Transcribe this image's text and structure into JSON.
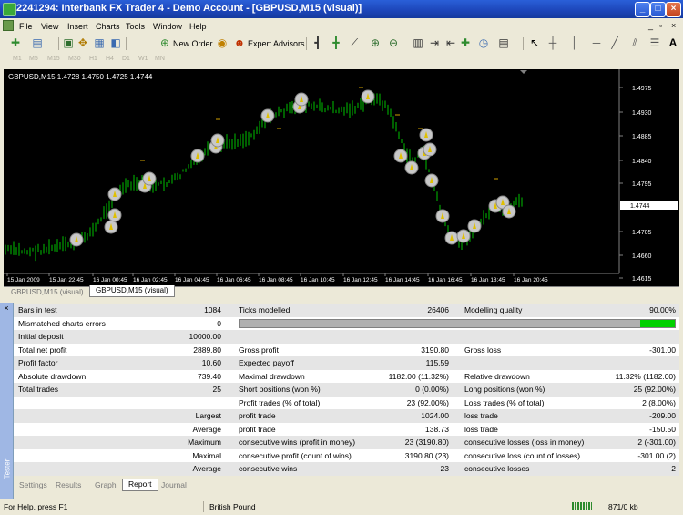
{
  "window": {
    "title": "2241294: Interbank FX Trader 4 - Demo Account - [GBPUSD,M15 (visual)]"
  },
  "menu": [
    "File",
    "View",
    "Insert",
    "Charts",
    "Tools",
    "Window",
    "Help"
  ],
  "toolbar": {
    "new_order_label": "New Order",
    "expert_advisors_label": "Expert Advisors"
  },
  "periods": [
    "M1",
    "M5",
    "M15",
    "M30",
    "H1",
    "H4",
    "D1",
    "W1",
    "MN"
  ],
  "chart": {
    "header": "GBPUSD,M15  1.4728 1.4750 1.4725 1.4744",
    "price_labels": [
      "1.4975",
      "1.4930",
      "1.4885",
      "1.4840",
      "1.4795",
      "1.4705",
      "1.4660",
      "1.4615"
    ],
    "current_price": "1.4744",
    "time_labels": [
      "15 Jan 2009",
      "15 Jan 22:45",
      "16 Jan 00:45",
      "16 Jan 02:45",
      "16 Jan 04:45",
      "16 Jan 06:45",
      "16 Jan 08:45",
      "16 Jan 10:45",
      "16 Jan 12:45",
      "16 Jan 14:45",
      "16 Jan 16:45",
      "16 Jan 18:45",
      "16 Jan 20:45"
    ],
    "colors": {
      "background": "#000000",
      "candle": "#00c000",
      "trade_marker": "#c8c8c8"
    }
  },
  "chart_tabs": [
    "GBPUSD,M15 (visual)",
    "GBPUSD,M15 (visual)"
  ],
  "report": {
    "rows": [
      {
        "c1": "Bars in test",
        "v1": "1084",
        "c2": "Ticks modelled",
        "v2": "26406",
        "c3": "Modelling quality",
        "v3": "90.00%"
      },
      {
        "c1": "Mismatched charts errors",
        "v1": "0",
        "c2": "",
        "v2": "",
        "c3": "",
        "v3": ""
      },
      {
        "c1": "Initial deposit",
        "v1": "10000.00",
        "c2": "",
        "v2": "",
        "c3": "",
        "v3": ""
      },
      {
        "c1": "Total net profit",
        "v1": "2889.80",
        "c2": "Gross profit",
        "v2": "3190.80",
        "c3": "Gross loss",
        "v3": "-301.00"
      },
      {
        "c1": "Profit factor",
        "v1": "10.60",
        "c2": "Expected payoff",
        "v2": "115.59",
        "c3": "",
        "v3": ""
      },
      {
        "c1": "Absolute drawdown",
        "v1": "739.40",
        "c2": "Maximal drawdown",
        "v2": "1182.00 (11.32%)",
        "c3": "Relative drawdown",
        "v3": "11.32% (1182.00)"
      },
      {
        "c1": "Total trades",
        "v1": "25",
        "c2": "Short positions (won %)",
        "v2": "0 (0.00%)",
        "c3": "Long positions (won %)",
        "v3": "25 (92.00%)"
      },
      {
        "c1": "",
        "v1": "",
        "c2": "Profit trades (% of total)",
        "v2": "23 (92.00%)",
        "c3": "Loss trades (% of total)",
        "v3": "2 (8.00%)"
      },
      {
        "c1": "",
        "v1": "Largest",
        "c2": "profit trade",
        "v2": "1024.00",
        "c3": "loss trade",
        "v3": "-209.00"
      },
      {
        "c1": "",
        "v1": "Average",
        "c2": "profit trade",
        "v2": "138.73",
        "c3": "loss trade",
        "v3": "-150.50"
      },
      {
        "c1": "",
        "v1": "Maximum",
        "c2": "consecutive wins (profit in money)",
        "v2": "23 (3190.80)",
        "c3": "consecutive losses (loss in money)",
        "v3": "2 (-301.00)"
      },
      {
        "c1": "",
        "v1": "Maximal",
        "c2": "consecutive profit (count of wins)",
        "v2": "3190.80 (23)",
        "c3": "consecutive loss (count of losses)",
        "v3": "-301.00 (2)"
      },
      {
        "c1": "",
        "v1": "Average",
        "c2": "consecutive wins",
        "v2": "23",
        "c3": "consecutive losses",
        "v3": "2"
      }
    ],
    "modelling_quality_fraction": 0.9,
    "colors": {
      "quality_bar": "#00d000",
      "quality_track": "#b0b0b0"
    }
  },
  "tester": {
    "side_label": "Tester",
    "tabs": [
      "Settings",
      "Results",
      "Graph",
      "Report",
      "Journal"
    ],
    "active_tab": "Report"
  },
  "status": {
    "help": "For Help, press F1",
    "profile": "British Pound",
    "traffic": "871/0 kb"
  }
}
